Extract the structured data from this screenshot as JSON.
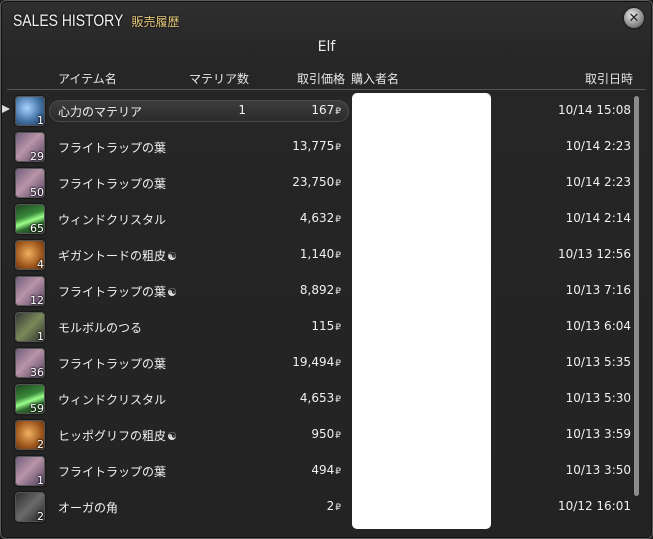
{
  "window": {
    "title": "SALES HISTORY",
    "title_jp": "販売履歴",
    "world": "Elf"
  },
  "columns": {
    "item": "アイテム名",
    "materia": "マテリア数",
    "price": "取引価格",
    "buyer": "購入者名",
    "date": "取引日時"
  },
  "currency_symbol": "₽",
  "rows": [
    {
      "icon": "materia-globe-icon",
      "qty": "1",
      "name": "心力のマテリア",
      "hq": "",
      "materia": "1",
      "price": "167",
      "date": "10/14 15:08"
    },
    {
      "icon": "leaf-icon",
      "qty": "29",
      "name": "フライトラップの葉",
      "hq": "",
      "materia": "",
      "price": "13,775",
      "date": "10/14 2:23"
    },
    {
      "icon": "leaf-icon",
      "qty": "50",
      "name": "フライトラップの葉",
      "hq": "",
      "materia": "",
      "price": "23,750",
      "date": "10/14 2:23"
    },
    {
      "icon": "wind-crystal-icon",
      "qty": "65",
      "name": "ウィンドクリスタル",
      "hq": "",
      "materia": "",
      "price": "4,632",
      "date": "10/14 2:14"
    },
    {
      "icon": "hide-icon",
      "qty": "4",
      "name": "ギガントードの粗皮",
      "hq": "☯",
      "materia": "",
      "price": "1,140",
      "date": "10/13 12:56"
    },
    {
      "icon": "leaf-icon",
      "qty": "12",
      "name": "フライトラップの葉",
      "hq": "☯",
      "materia": "",
      "price": "8,892",
      "date": "10/13 7:16"
    },
    {
      "icon": "vine-icon",
      "qty": "1",
      "name": "モルボルのつる",
      "hq": "",
      "materia": "",
      "price": "115",
      "date": "10/13 6:04"
    },
    {
      "icon": "leaf-icon",
      "qty": "36",
      "name": "フライトラップの葉",
      "hq": "",
      "materia": "",
      "price": "19,494",
      "date": "10/13 5:35"
    },
    {
      "icon": "wind-crystal-icon",
      "qty": "59",
      "name": "ウィンドクリスタル",
      "hq": "",
      "materia": "",
      "price": "4,653",
      "date": "10/13 5:30"
    },
    {
      "icon": "hide-icon",
      "qty": "2",
      "name": "ヒッポグリフの粗皮",
      "hq": "☯",
      "materia": "",
      "price": "950",
      "date": "10/13 3:59"
    },
    {
      "icon": "leaf-icon",
      "qty": "1",
      "name": "フライトラップの葉",
      "hq": "",
      "materia": "",
      "price": "494",
      "date": "10/13 3:50"
    },
    {
      "icon": "horn-icon",
      "qty": "2",
      "name": "オーガの角",
      "hq": "",
      "materia": "",
      "price": "2",
      "date": "10/12 16:01"
    }
  ],
  "colors": {
    "background": "#262626",
    "accent_title_jp": "#e6c77a",
    "buyer_mask": "#ffffff"
  }
}
